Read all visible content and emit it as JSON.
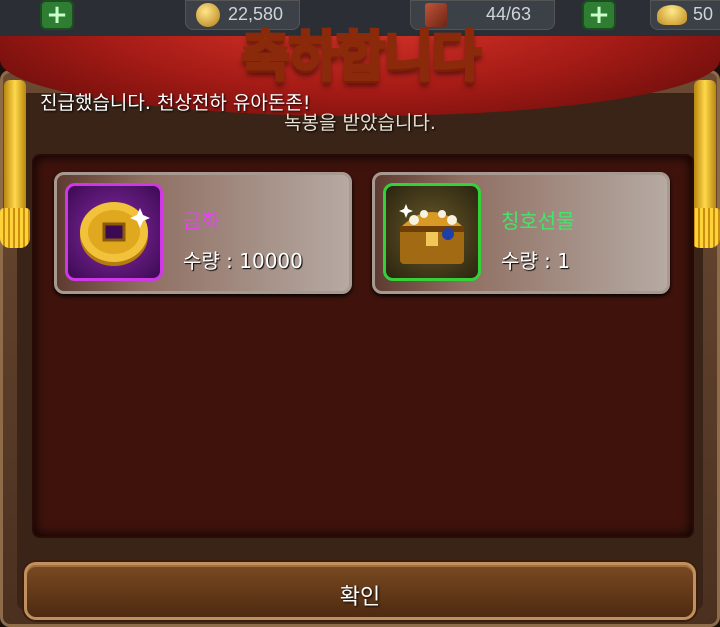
{
  "topbar": {
    "gold": "22,580",
    "capacity": "44/63",
    "ingot": "50"
  },
  "modal": {
    "title": "축하합니다",
    "announcement": "진급했습니다. 천상전하 유아돈존!",
    "subtitle": "녹봉을 받았습니다."
  },
  "rewards": [
    {
      "name": "금화",
      "qty_label": "수량 : 10000",
      "icon": "gold-coin-icon"
    },
    {
      "name": "칭호선물",
      "qty_label": "수량 : 1",
      "icon": "treasure-chest-icon"
    }
  ],
  "confirm_label": "확인",
  "colors": {
    "title_gold": "#ffcc2a",
    "item_purple": "#e443f0",
    "item_green": "#44e66a"
  }
}
